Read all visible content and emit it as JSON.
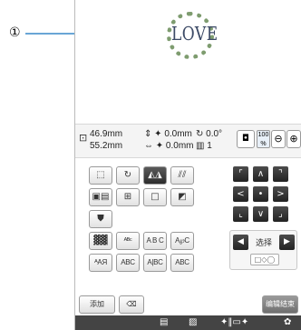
{
  "callout": {
    "marker": "①"
  },
  "preview": {
    "design_text": "LOVE"
  },
  "info": {
    "size_icon": "⊡",
    "width": "46.9mm",
    "height": "55.2mm",
    "move_v": "⇕ ✦   0.0mm",
    "move_h": "⇔ ✦   0.0mm",
    "rotate": "↻   0.0°",
    "color_count": "▥   1",
    "camera_icon": "◘",
    "zoom_value": "100",
    "zoom_unit": "%",
    "zoom_out_icon": "⊖",
    "zoom_in_icon": "⊕"
  },
  "toolbar": {
    "row1": [
      "⬚",
      "↻",
      "◭◮",
      "⫽⫽"
    ],
    "row2": [
      "▣▤",
      "⊞",
      "□",
      "◩"
    ],
    "row3": [
      "⛊"
    ],
    "row4": [
      "▓▓",
      "ᴬᴮᶜ",
      "A B C",
      "A℘C"
    ],
    "row5": [
      "ᴬAЯ",
      "ABC",
      "A|BC",
      "ABC"
    ]
  },
  "dpad": [
    "⌜",
    "∧",
    "⌝",
    "<",
    "•",
    ">",
    "⌞",
    "∨",
    "⌟"
  ],
  "select": {
    "left": "◀",
    "label": "选择",
    "right": "▶",
    "shapes": "□◇◯"
  },
  "actions": {
    "add": "添加",
    "eraser_icon": "⌫",
    "edit_end": "编辑结束"
  },
  "status": {
    "page_icon": "▤",
    "frame_icon": "▨",
    "needle_icon": "✦‖▭✦",
    "settings_icon": "✿"
  }
}
